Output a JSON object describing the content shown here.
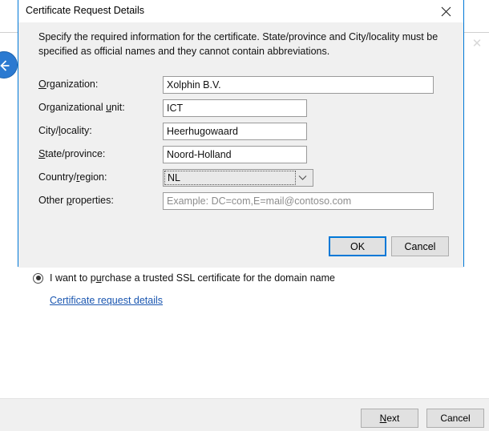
{
  "background": {
    "back_button_icon": "arrow-left-icon",
    "close_icon": "close-icon",
    "radio": {
      "label_before": "I want to p",
      "accesskey": "u",
      "label_after": "rchase a trusted SSL certificate for the domain name",
      "checked": true
    },
    "link_text": "Certificate request details",
    "buttons": {
      "next_before": "N",
      "next_accesskey": "e",
      "next_after": "xt",
      "cancel": "Cancel"
    }
  },
  "dialog": {
    "title": "Certificate Request Details",
    "close_icon": "close-icon",
    "instruction": "Specify the required information for the certificate. State/province and City/locality must be specified as official names and they cannot contain abbreviations.",
    "fields": [
      {
        "label_before": "",
        "accesskey": "O",
        "label_after": "rganization:",
        "value": "Xolphin B.V.",
        "placeholder": "",
        "type": "text-wide",
        "name": "organization"
      },
      {
        "label_before": "Organizational ",
        "accesskey": "u",
        "label_after": "nit:",
        "value": "ICT",
        "placeholder": "",
        "type": "text-narrow",
        "name": "organizational-unit"
      },
      {
        "label_before": "City/",
        "accesskey": "l",
        "label_after": "ocality:",
        "value": "Heerhugowaard",
        "placeholder": "",
        "type": "text-narrow",
        "name": "city-locality"
      },
      {
        "label_before": "",
        "accesskey": "S",
        "label_after": "tate/province:",
        "value": "Noord-Holland",
        "placeholder": "",
        "type": "text-narrow",
        "name": "state-province"
      },
      {
        "label_before": "Country/",
        "accesskey": "r",
        "label_after": "egion:",
        "value": "NL",
        "placeholder": "",
        "type": "select",
        "name": "country-region"
      },
      {
        "label_before": "Other ",
        "accesskey": "p",
        "label_after": "roperties:",
        "value": "",
        "placeholder": "Example: DC=com,E=mail@contoso.com",
        "type": "text-wide",
        "name": "other-properties"
      }
    ],
    "buttons": {
      "ok": "OK",
      "cancel": "Cancel"
    }
  },
  "colors": {
    "accent": "#0078d7",
    "dialog_bg": "#f0f0f0",
    "link": "#1a56b0",
    "back_button": "#2b7ad1",
    "page_bg": "#ffffff"
  }
}
